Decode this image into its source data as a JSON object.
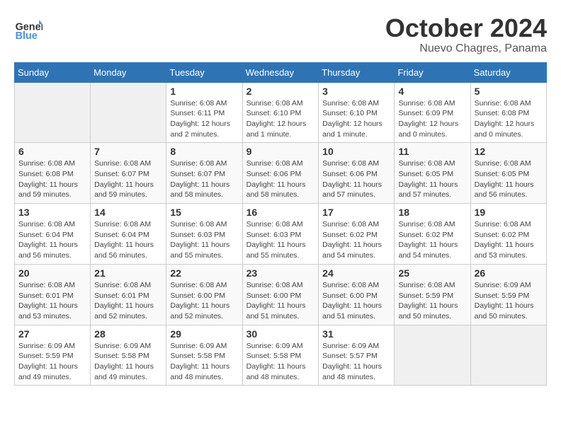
{
  "header": {
    "logo_general": "General",
    "logo_blue": "Blue",
    "month_title": "October 2024",
    "subtitle": "Nuevo Chagres, Panama"
  },
  "weekdays": [
    "Sunday",
    "Monday",
    "Tuesday",
    "Wednesday",
    "Thursday",
    "Friday",
    "Saturday"
  ],
  "weeks": [
    [
      {
        "day": "",
        "info": ""
      },
      {
        "day": "",
        "info": ""
      },
      {
        "day": "1",
        "info": "Sunrise: 6:08 AM\nSunset: 6:11 PM\nDaylight: 12 hours\nand 2 minutes."
      },
      {
        "day": "2",
        "info": "Sunrise: 6:08 AM\nSunset: 6:10 PM\nDaylight: 12 hours\nand 1 minute."
      },
      {
        "day": "3",
        "info": "Sunrise: 6:08 AM\nSunset: 6:10 PM\nDaylight: 12 hours\nand 1 minute."
      },
      {
        "day": "4",
        "info": "Sunrise: 6:08 AM\nSunset: 6:09 PM\nDaylight: 12 hours\nand 0 minutes."
      },
      {
        "day": "5",
        "info": "Sunrise: 6:08 AM\nSunset: 6:08 PM\nDaylight: 12 hours\nand 0 minutes."
      }
    ],
    [
      {
        "day": "6",
        "info": "Sunrise: 6:08 AM\nSunset: 6:08 PM\nDaylight: 11 hours\nand 59 minutes."
      },
      {
        "day": "7",
        "info": "Sunrise: 6:08 AM\nSunset: 6:07 PM\nDaylight: 11 hours\nand 59 minutes."
      },
      {
        "day": "8",
        "info": "Sunrise: 6:08 AM\nSunset: 6:07 PM\nDaylight: 11 hours\nand 58 minutes."
      },
      {
        "day": "9",
        "info": "Sunrise: 6:08 AM\nSunset: 6:06 PM\nDaylight: 11 hours\nand 58 minutes."
      },
      {
        "day": "10",
        "info": "Sunrise: 6:08 AM\nSunset: 6:06 PM\nDaylight: 11 hours\nand 57 minutes."
      },
      {
        "day": "11",
        "info": "Sunrise: 6:08 AM\nSunset: 6:05 PM\nDaylight: 11 hours\nand 57 minutes."
      },
      {
        "day": "12",
        "info": "Sunrise: 6:08 AM\nSunset: 6:05 PM\nDaylight: 11 hours\nand 56 minutes."
      }
    ],
    [
      {
        "day": "13",
        "info": "Sunrise: 6:08 AM\nSunset: 6:04 PM\nDaylight: 11 hours\nand 56 minutes."
      },
      {
        "day": "14",
        "info": "Sunrise: 6:08 AM\nSunset: 6:04 PM\nDaylight: 11 hours\nand 56 minutes."
      },
      {
        "day": "15",
        "info": "Sunrise: 6:08 AM\nSunset: 6:03 PM\nDaylight: 11 hours\nand 55 minutes."
      },
      {
        "day": "16",
        "info": "Sunrise: 6:08 AM\nSunset: 6:03 PM\nDaylight: 11 hours\nand 55 minutes."
      },
      {
        "day": "17",
        "info": "Sunrise: 6:08 AM\nSunset: 6:02 PM\nDaylight: 11 hours\nand 54 minutes."
      },
      {
        "day": "18",
        "info": "Sunrise: 6:08 AM\nSunset: 6:02 PM\nDaylight: 11 hours\nand 54 minutes."
      },
      {
        "day": "19",
        "info": "Sunrise: 6:08 AM\nSunset: 6:02 PM\nDaylight: 11 hours\nand 53 minutes."
      }
    ],
    [
      {
        "day": "20",
        "info": "Sunrise: 6:08 AM\nSunset: 6:01 PM\nDaylight: 11 hours\nand 53 minutes."
      },
      {
        "day": "21",
        "info": "Sunrise: 6:08 AM\nSunset: 6:01 PM\nDaylight: 11 hours\nand 52 minutes."
      },
      {
        "day": "22",
        "info": "Sunrise: 6:08 AM\nSunset: 6:00 PM\nDaylight: 11 hours\nand 52 minutes."
      },
      {
        "day": "23",
        "info": "Sunrise: 6:08 AM\nSunset: 6:00 PM\nDaylight: 11 hours\nand 51 minutes."
      },
      {
        "day": "24",
        "info": "Sunrise: 6:08 AM\nSunset: 6:00 PM\nDaylight: 11 hours\nand 51 minutes."
      },
      {
        "day": "25",
        "info": "Sunrise: 6:08 AM\nSunset: 5:59 PM\nDaylight: 11 hours\nand 50 minutes."
      },
      {
        "day": "26",
        "info": "Sunrise: 6:09 AM\nSunset: 5:59 PM\nDaylight: 11 hours\nand 50 minutes."
      }
    ],
    [
      {
        "day": "27",
        "info": "Sunrise: 6:09 AM\nSunset: 5:59 PM\nDaylight: 11 hours\nand 49 minutes."
      },
      {
        "day": "28",
        "info": "Sunrise: 6:09 AM\nSunset: 5:58 PM\nDaylight: 11 hours\nand 49 minutes."
      },
      {
        "day": "29",
        "info": "Sunrise: 6:09 AM\nSunset: 5:58 PM\nDaylight: 11 hours\nand 48 minutes."
      },
      {
        "day": "30",
        "info": "Sunrise: 6:09 AM\nSunset: 5:58 PM\nDaylight: 11 hours\nand 48 minutes."
      },
      {
        "day": "31",
        "info": "Sunrise: 6:09 AM\nSunset: 5:57 PM\nDaylight: 11 hours\nand 48 minutes."
      },
      {
        "day": "",
        "info": ""
      },
      {
        "day": "",
        "info": ""
      }
    ]
  ]
}
